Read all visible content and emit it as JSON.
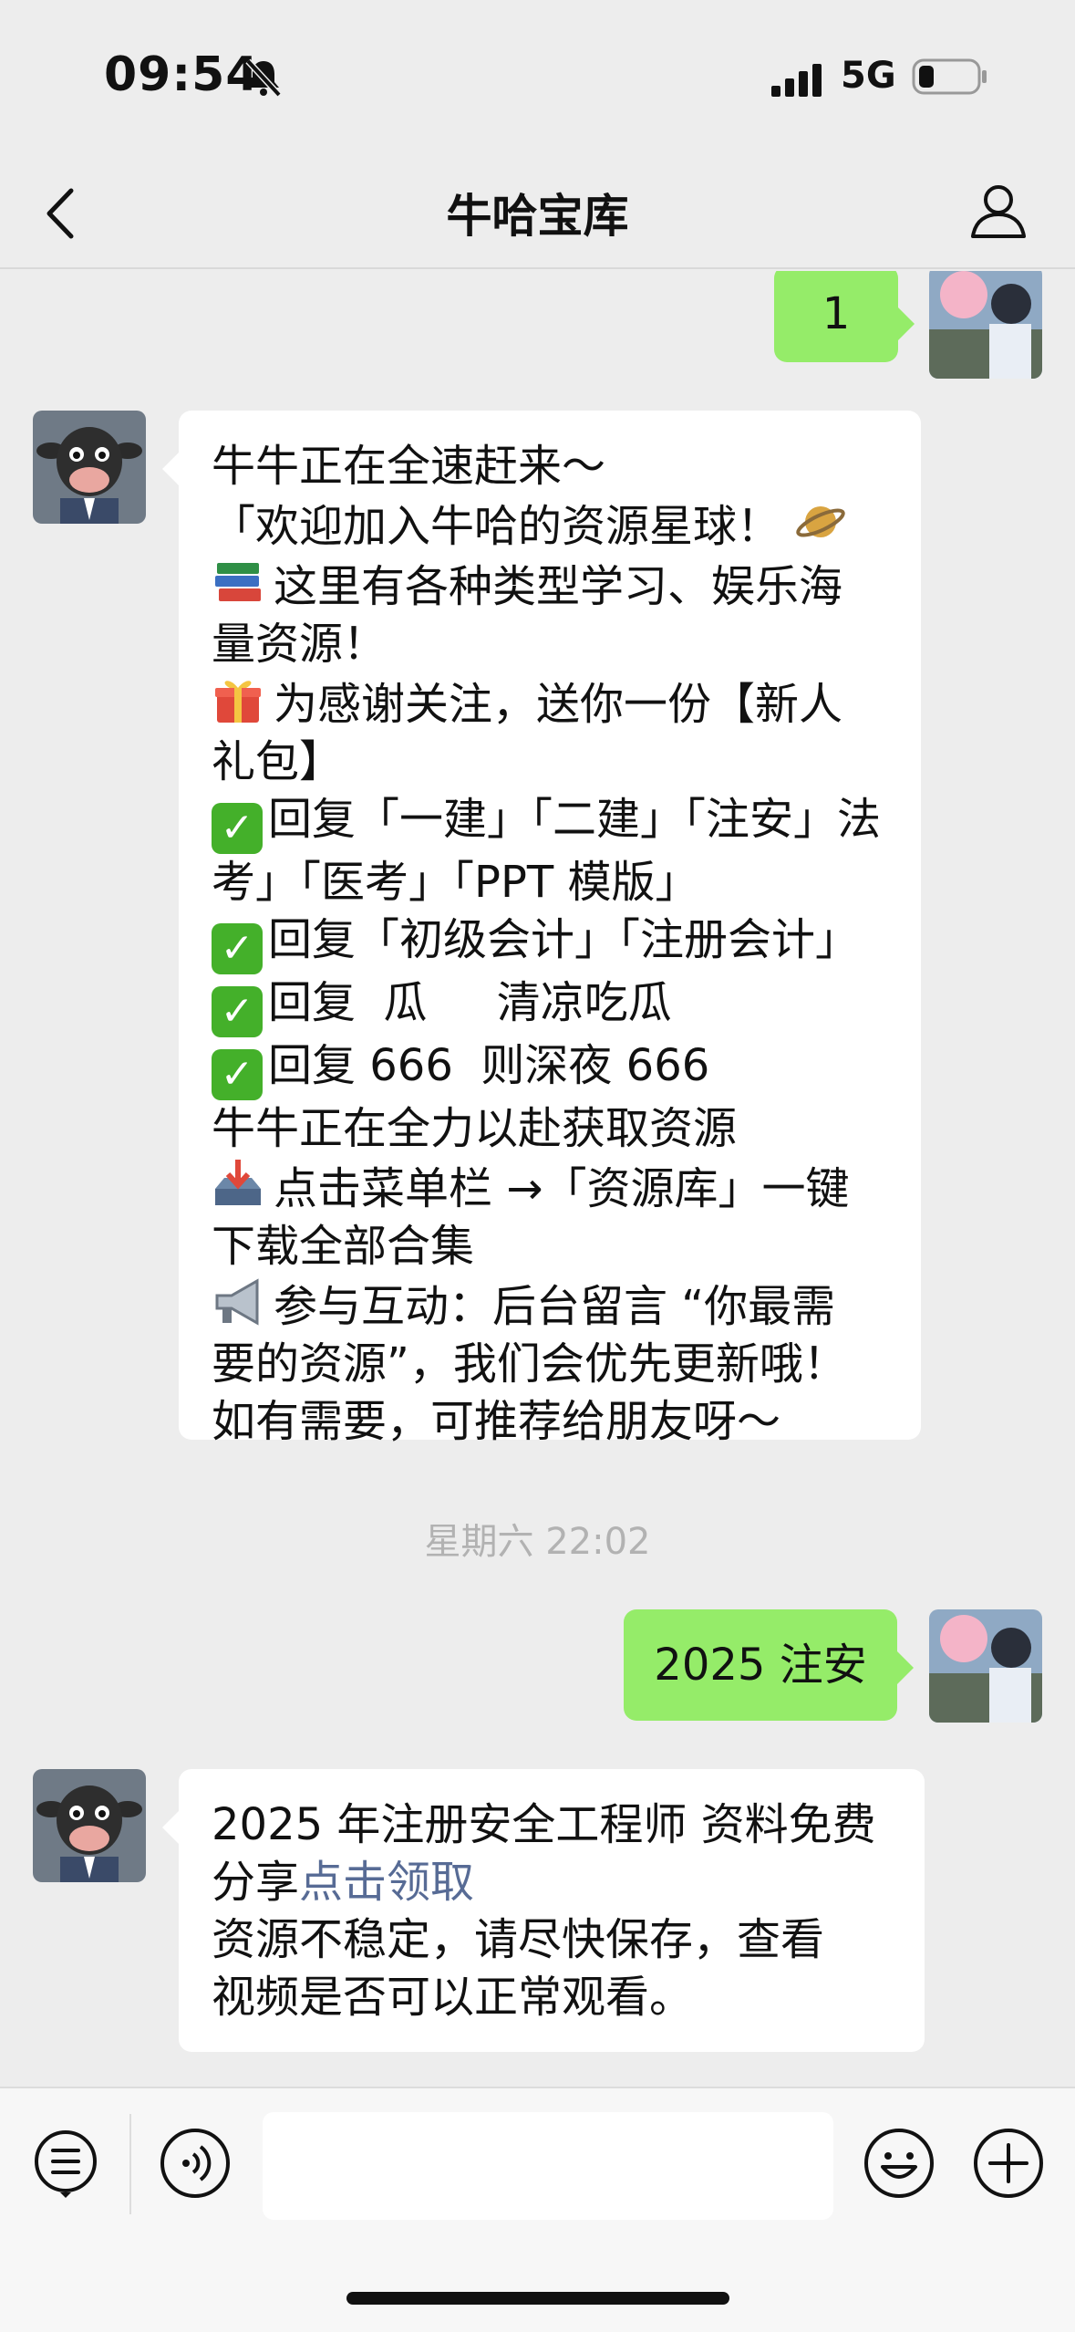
{
  "status_bar": {
    "time": "09:54",
    "network": "5G"
  },
  "nav": {
    "title": "牛哈宝库"
  },
  "messages": {
    "m1_out": "1",
    "m2_in": {
      "l1": "牛牛正在全速赶来～",
      "l2": "「欢迎加入牛哈的资源星球！",
      "l3": "这里有各种类型学习、娱乐海",
      "l4": "量资源！",
      "l5": "为感谢关注，送你一份【新人",
      "l6": "礼包】",
      "l7": "回复「一建」「二建」「注安」法",
      "l8": "考」「医考」「PPT 模版」",
      "l9": "回复「初级会计」「注册会计」",
      "l10": "回复  瓜     清凉吃瓜",
      "l11": "回复 666  则深夜 666",
      "l12": "牛牛正在全力以赴获取资源",
      "l13": "点击菜单栏 →「资源库」一键",
      "l14": "下载全部合集",
      "l15": "参与互动：后台留言 “你最需",
      "l16": "要的资源”，我们会优先更新哦！",
      "l17": "如有需要，可推荐给朋友呀～"
    },
    "timestamp": "星期六 22:02",
    "m3_out": "2025 注安",
    "m4_in": {
      "l1": "2025 年注册安全工程师 资料免费",
      "l2a": "分享",
      "l2_link": "点击领取",
      "l3": "资源不稳定，请尽快保存，查看",
      "l4": "视频是否可以正常观看。"
    }
  },
  "icons": {
    "status": [
      "bell-off-icon",
      "signal-icon",
      "battery-icon"
    ],
    "nav": [
      "back-icon",
      "profile-icon"
    ],
    "message_emojis": [
      "ringed-planet-icon",
      "books-icon",
      "gift-icon",
      "check-mark-icon",
      "inbox-tray-icon",
      "megaphone-icon"
    ],
    "input_bar": [
      "menu-list-icon",
      "voice-icon",
      "emoji-icon",
      "plus-icon"
    ]
  },
  "colors": {
    "outgoing_bubble": "#95ec69",
    "incoming_bubble": "#ffffff",
    "link": "#576b95",
    "background": "#ededed"
  }
}
